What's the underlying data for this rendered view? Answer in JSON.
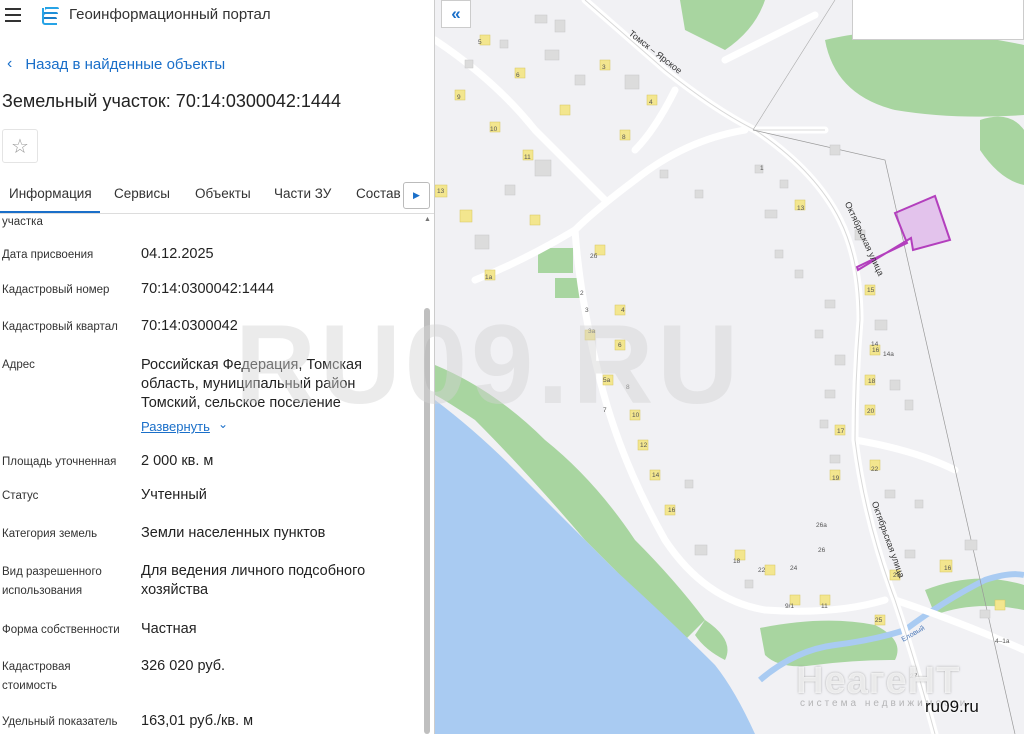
{
  "header": {
    "title": "Геоинформационный портал",
    "menu_icon": "hamburger-icon",
    "logo_icon": "portal-logo-icon"
  },
  "back_link": {
    "label": "Назад в найденные объекты"
  },
  "object": {
    "title": "Земельный участок: 70:14:0300042:1444"
  },
  "tabs": [
    {
      "label": "Информация",
      "active": true
    },
    {
      "label": "Сервисы"
    },
    {
      "label": "Объекты"
    },
    {
      "label": "Части ЗУ"
    },
    {
      "label": "Состав"
    }
  ],
  "info": {
    "partial_label": "участка",
    "fields": [
      {
        "label": "Дата присвоения",
        "value": "04.12.2025"
      },
      {
        "label": "Кадастровый номер",
        "value": "70:14:0300042:1444"
      },
      {
        "label": "Кадастровый квартал",
        "value": "70:14:0300042"
      },
      {
        "label": "Адрес",
        "value": "Российская Федерация, Томская область, муниципальный район Томский, сельское поселение"
      },
      {
        "label": "Площадь уточненная",
        "value": "2 000 кв. м"
      },
      {
        "label": "Статус",
        "value": "Учтенный"
      },
      {
        "label": "Категория земель",
        "value": "Земли населенных пунктов"
      },
      {
        "label": "Вид разрешенного использования",
        "value": "Для ведения личного подсобного хозяйства"
      },
      {
        "label": "Форма собственности",
        "value": "Частная"
      },
      {
        "label": "Кадастровая стоимость",
        "value": "326 020 руб."
      },
      {
        "label": "Удельный показатель",
        "value": "163,01 руб./кв. м"
      }
    ],
    "expand_label": "Развернуть"
  },
  "map": {
    "labels": {
      "road_tomsk": "Томск – Ярское",
      "street_oct_1": "Октябрьская улица",
      "street_oct_2": "Октябрьская улица",
      "creek": "Еловый"
    },
    "house_numbers": [
      "5",
      "6",
      "3",
      "9",
      "4",
      "10",
      "8",
      "11",
      "13",
      "1",
      "1а",
      "2б",
      "2",
      "3",
      "4",
      "3а",
      "6",
      "5а",
      "8",
      "7",
      "10",
      "12",
      "14",
      "16",
      "18",
      "22",
      "26",
      "26а",
      "24",
      "13",
      "15",
      "16",
      "17",
      "18",
      "19",
      "20",
      "14",
      "14а",
      "22",
      "27",
      "25",
      "4–1а",
      "11",
      "9/1",
      "20",
      "16"
    ],
    "colors": {
      "water": "#a9cbf2",
      "forest": "#a8d5a0",
      "parcel": "#c255c8",
      "road": "#ffffff"
    }
  },
  "watermarks": {
    "center": "RU09.RU",
    "agency": "НеагеНТ",
    "agency_sub": "системa недвижимости",
    "site": "ru09.ru"
  }
}
